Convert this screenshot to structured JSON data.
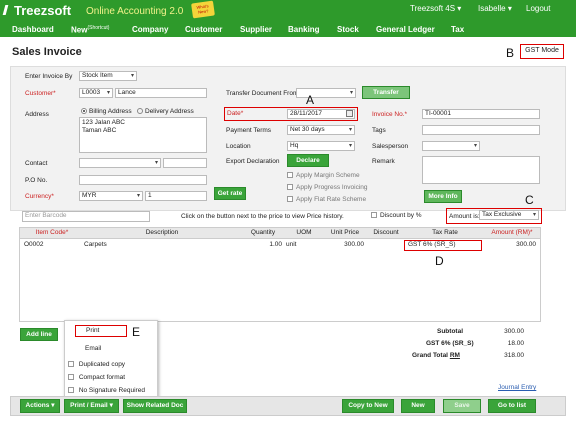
{
  "brand": {
    "name": "Treezsoft",
    "app_title": "Online Accounting 2.0",
    "sticker": "What's New?"
  },
  "user": {
    "company": "Treezsoft 4S",
    "user": "Isabelle",
    "logout": "Logout"
  },
  "menu": [
    "Dashboard",
    "New",
    "Company",
    "Customer",
    "Supplier",
    "Banking",
    "Stock",
    "General Ledger",
    "Tax"
  ],
  "menu_new_sup": "(Shortcut)",
  "page": {
    "title": "Sales Invoice",
    "gst_mode": "GST Mode"
  },
  "callouts": {
    "a": "A",
    "b": "B",
    "c": "C",
    "d": "D",
    "e": "E"
  },
  "form": {
    "enter_by_label": "Enter Invoice By",
    "enter_by_value": "Stock Item",
    "customer_label": "Customer*",
    "customer_code": "L0003",
    "customer_name": "Lance",
    "address_label": "Address",
    "billing": "Billing Address",
    "delivery": "Delivery Address",
    "address_line1": "123 Jalan ABC",
    "address_line2": "Taman ABC",
    "contact_label": "Contact",
    "po_label": "P.O No.",
    "currency_label": "Currency*",
    "currency_value": "MYR",
    "rate_value": "1",
    "get_rate": "Get rate",
    "transfer_label": "Transfer Document From",
    "transfer_btn": "Transfer",
    "date_label": "Date*",
    "date_value": "28/11/2017",
    "payment_label": "Payment Terms",
    "payment_value": "Net 30 days",
    "location_label": "Location",
    "location_value": "Hq",
    "export_label": "Export Declaration",
    "declare_btn": "Declare",
    "margin": "Apply Margin Scheme",
    "progress": "Apply Progress Invoicing",
    "flat": "Apply Flat Rate Scheme",
    "invoice_label": "Invoice No.*",
    "invoice_value": "TI-00001",
    "tags_label": "Tags",
    "salesperson_label": "Salesperson",
    "remark_label": "Remark",
    "more_info": "More Info"
  },
  "barcode_placeholder": "Enter Barcode",
  "price_hint": "Click on the button next to the price to view Price history.",
  "discount_pct": "Discount by %",
  "amount_is_label": "Amount is:",
  "amount_is_value": "Tax Exclusive",
  "grid": {
    "headers": [
      "Item Code*",
      "Description",
      "Quantity",
      "UOM",
      "Unit Price",
      "Discount",
      "Tax Rate",
      "Amount (RM)*"
    ],
    "rows": [
      {
        "code": "O0002",
        "desc": "Carpets",
        "qty": "1.00",
        "uom": "unit",
        "price": "300.00",
        "discount": "",
        "tax": "GST 6% (SR_S)",
        "amount": "300.00"
      }
    ]
  },
  "add_line": "Add line",
  "totals": {
    "subtotal_label": "Subtotal",
    "subtotal": "300.00",
    "gst_label": "GST 6% (SR_S)",
    "gst": "18.00",
    "grand_label": "Grand Total",
    "grand_cur": "RM",
    "grand": "318.00"
  },
  "journal_entry": "Journal Entry",
  "dropdown": {
    "print": "Print",
    "email": "Email",
    "dup": "Duplicated copy",
    "compact": "Compact format",
    "nosig": "No Signature Required"
  },
  "footer": {
    "actions": "Actions",
    "print_email": "Print / Email",
    "show_related": "Show Related Doc",
    "copy_to_new": "Copy to New",
    "new": "New",
    "save": "Save",
    "go_to_list": "Go to list"
  }
}
